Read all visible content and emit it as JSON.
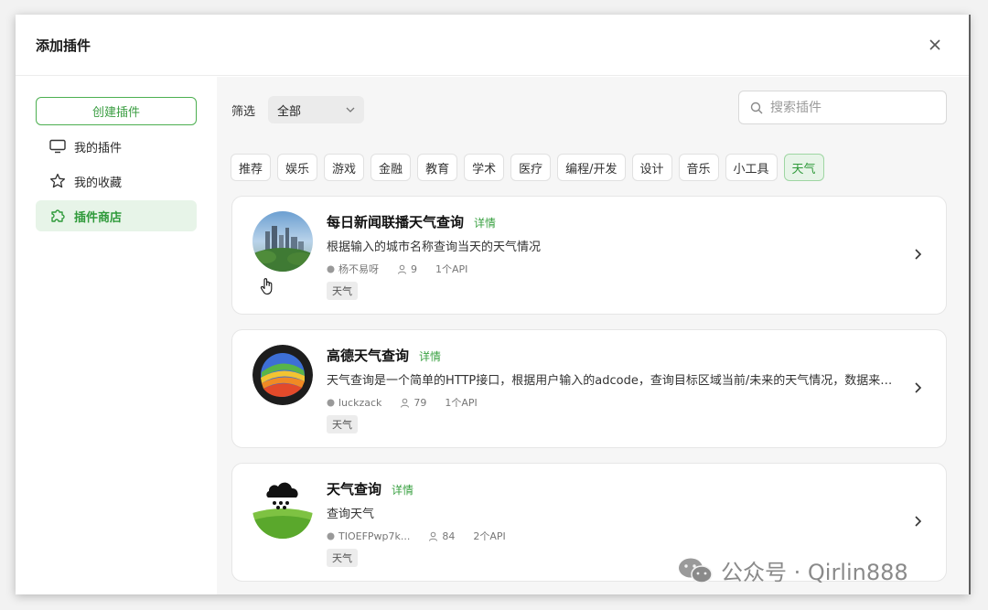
{
  "dialog": {
    "title": "添加插件"
  },
  "sidebar": {
    "create_label": "创建插件",
    "items": [
      {
        "label": "我的插件",
        "icon": "monitor-icon",
        "active": false
      },
      {
        "label": "我的收藏",
        "icon": "star-icon",
        "active": false
      },
      {
        "label": "插件商店",
        "icon": "puzzle-icon",
        "active": true
      }
    ]
  },
  "filter": {
    "label": "筛选",
    "selected": "全部"
  },
  "search": {
    "placeholder": "搜索插件"
  },
  "categories": [
    "推荐",
    "娱乐",
    "游戏",
    "金融",
    "教育",
    "学术",
    "医疗",
    "编程/开发",
    "设计",
    "音乐",
    "小工具",
    "天气"
  ],
  "active_category": "天气",
  "plugins": [
    {
      "title": "每日新闻联播天气查询",
      "detail": "详情",
      "desc": "根据输入的城市名称查询当天的天气情况",
      "author": "杨不易呀",
      "users": "9",
      "apis": "1个API",
      "tag": "天气"
    },
    {
      "title": "高德天气查询",
      "detail": "详情",
      "desc": "天气查询是一个简单的HTTP接口，根据用户输入的adcode，查询目标区域当前/未来的天气情况，数据来源是中国气象局。",
      "author": "luckzack",
      "users": "79",
      "apis": "1个API",
      "tag": "天气"
    },
    {
      "title": "天气查询",
      "detail": "详情",
      "desc": "查询天气",
      "author": "TIOEFPwp7k...",
      "users": "84",
      "apis": "2个API",
      "tag": "天气"
    }
  ],
  "watermark": "公众号 · Qirlin888",
  "colors": {
    "accent": "#3aa142",
    "accent_bg": "#e7f4e8"
  }
}
